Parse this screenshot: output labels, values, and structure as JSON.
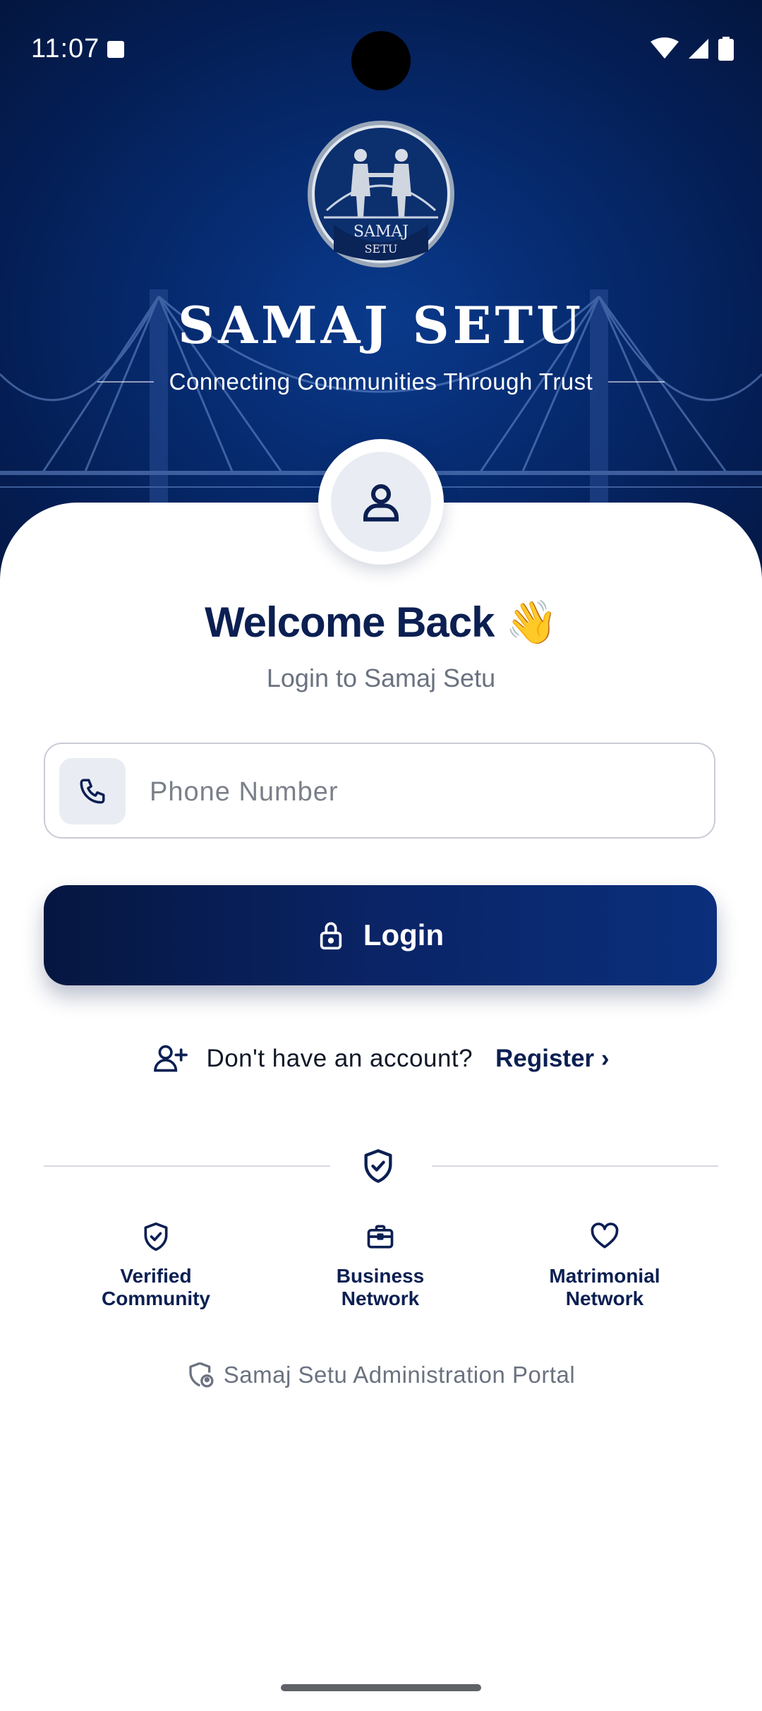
{
  "status_bar": {
    "time": "11:07"
  },
  "brand": {
    "title": "SAMAJ SETU",
    "tagline": "Connecting Communities Through Trust",
    "logo_text_top": "SAMAJ",
    "logo_text_bottom": "SETU"
  },
  "welcome": {
    "title": "Welcome Back 👋",
    "subtitle": "Login to Samaj Setu"
  },
  "phone_field": {
    "placeholder": "Phone Number",
    "value": ""
  },
  "login_button": {
    "label": "Login"
  },
  "register": {
    "question": "Don't have an account?",
    "link_label": "Register ›"
  },
  "features": [
    {
      "icon": "shield-check-icon",
      "label": "Verified\nCommunity"
    },
    {
      "icon": "briefcase-icon",
      "label": "Business\nNetwork"
    },
    {
      "icon": "heart-icon",
      "label": "Matrimonial\nNetwork"
    }
  ],
  "portal": {
    "label": "Samaj Setu Administration Portal"
  },
  "colors": {
    "navy": "#0b1f52",
    "hero_dark": "#03163f",
    "hero_light": "#0a3a8c"
  }
}
